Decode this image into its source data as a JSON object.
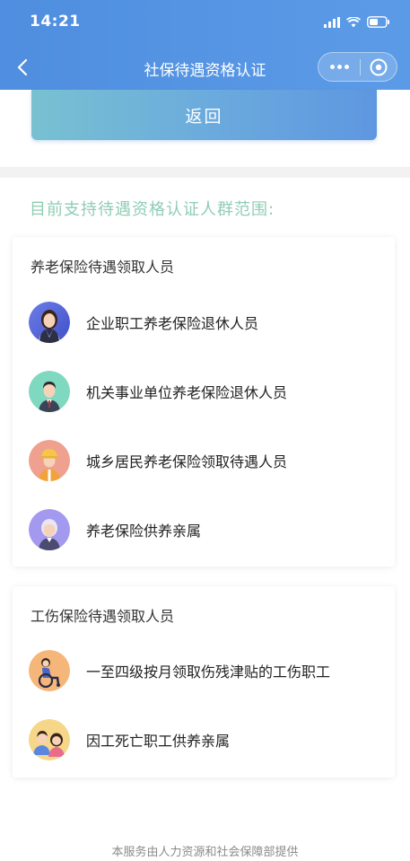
{
  "status_bar": {
    "time": "14:21"
  },
  "nav": {
    "title": "社保待遇资格认证"
  },
  "return_button": {
    "label": "返回"
  },
  "section": {
    "title": "目前支持待遇资格认证人群范围:"
  },
  "pension_group": {
    "title": "养老保险待遇领取人员",
    "items": [
      {
        "label": "企业职工养老保险退休人员"
      },
      {
        "label": "机关事业单位养老保险退休人员"
      },
      {
        "label": "城乡居民养老保险领取待遇人员"
      },
      {
        "label": "养老保险供养亲属"
      }
    ]
  },
  "injury_group": {
    "title": "工伤保险待遇领取人员",
    "items": [
      {
        "label": "一至四级按月领取伤残津贴的工伤职工"
      },
      {
        "label": "因工死亡职工供养亲属"
      }
    ]
  },
  "footer": {
    "text": "本服务由人力资源和社会保障部提供"
  },
  "colors": {
    "header": "#5b9be6",
    "section_title": "#8fcdb4"
  }
}
